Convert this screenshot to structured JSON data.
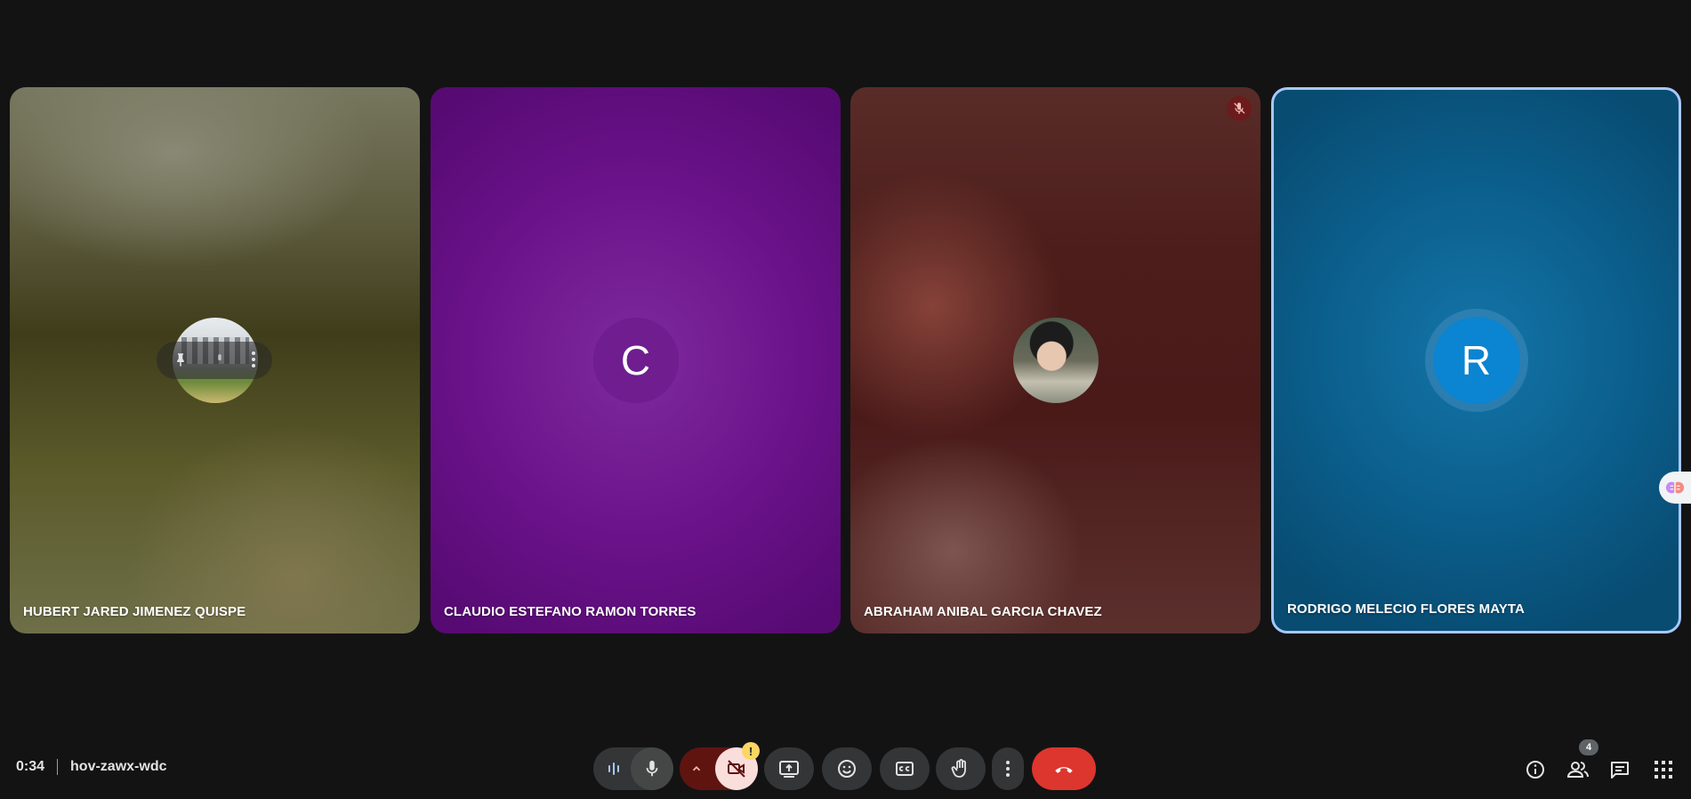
{
  "participants": [
    {
      "name": "HUBERT JARED JIMENEZ QUISPE",
      "avatar": "photo",
      "avatar_color": "#77775f"
    },
    {
      "name": "CLAUDIO ESTEFANO RAMON TORRES",
      "avatar": "C",
      "avatar_color": "#6f1d8f"
    },
    {
      "name": "ABRAHAM ANIBAL GARCIA CHAVEZ",
      "avatar": "photo",
      "avatar_color": "#4a1a19",
      "muted": true
    },
    {
      "name": "RODRIGO MELECIO FLORES MAYTA",
      "avatar": "R",
      "avatar_color": "#0b84d1",
      "speaking": true
    }
  ],
  "meeting": {
    "time": "0:34",
    "code": "hov-zawx-wdc"
  },
  "people_count": "4",
  "camera_warning": "!",
  "controls": {
    "icons": [
      "audio-level-icon",
      "microphone-icon",
      "chevron-up-icon",
      "camera-off-icon",
      "present-screen-icon",
      "emoji-icon",
      "captions-icon",
      "raise-hand-icon",
      "more-options-icon",
      "end-call-icon"
    ],
    "end_call_color": "#dc362e",
    "camera_off_color": "#f9dedc"
  },
  "right_icons": [
    "info-icon",
    "people-icon",
    "chat-icon",
    "apps-icon"
  ],
  "colors": {
    "background": "#131314",
    "active_speaker_border": "#a8c7fa"
  }
}
